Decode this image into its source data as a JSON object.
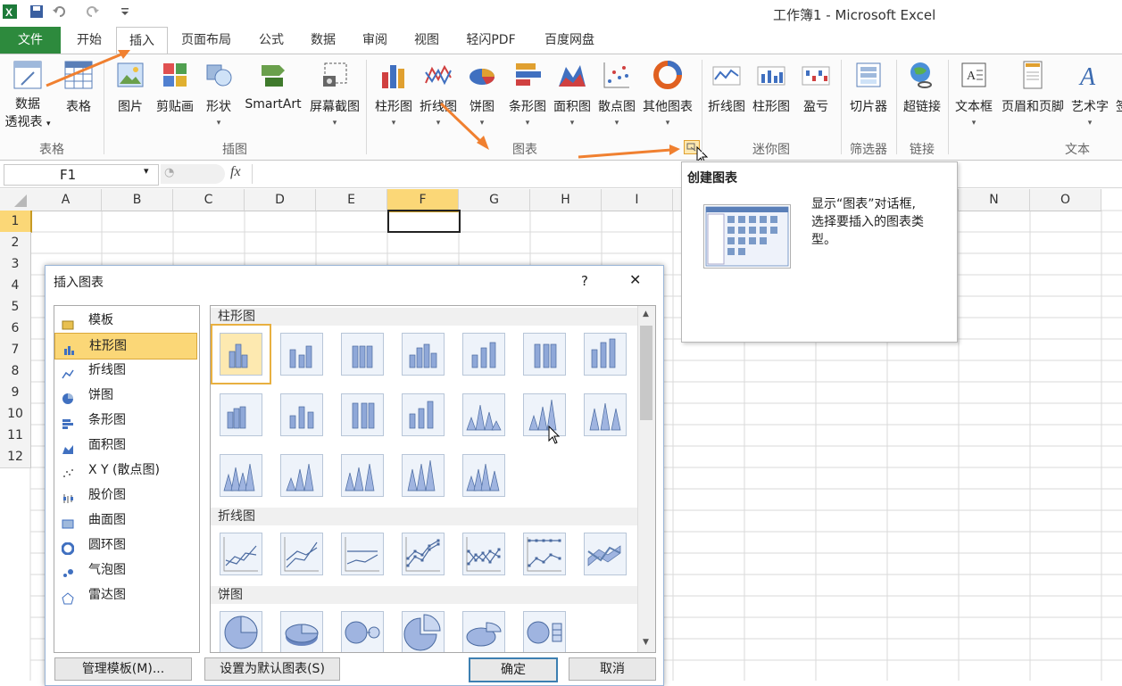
{
  "window": {
    "title": "工作簿1 - Microsoft Excel"
  },
  "tabs": [
    "文件",
    "开始",
    "插入",
    "页面布局",
    "公式",
    "数据",
    "审阅",
    "视图",
    "轻闪PDF",
    "百度网盘"
  ],
  "ribbon": {
    "groups": {
      "tables": "表格",
      "illustrations": "插图",
      "charts": "图表",
      "sparklines": "迷你图",
      "filter": "筛选器",
      "links": "链接",
      "text": "文本"
    },
    "buttons": {
      "pivot_line1": "数据",
      "pivot_line2": "透视表",
      "table": "表格",
      "picture": "图片",
      "clipart": "剪贴画",
      "shapes": "形状",
      "smartart": "SmartArt",
      "screenshot": "屏幕截图",
      "column": "柱形图",
      "line": "折线图",
      "pie": "饼图",
      "bar": "条形图",
      "area": "面积图",
      "scatter": "散点图",
      "other": "其他图表",
      "spark_line": "折线图",
      "spark_column": "柱形图",
      "spark_winloss": "盈亏",
      "slicer": "切片器",
      "hyperlink": "超链接",
      "textbox": "文本框",
      "header_footer": "页眉和页脚",
      "wordart": "艺术字",
      "sign": "签"
    },
    "dropdown_arrow": "▾"
  },
  "formula_bar": {
    "name_box": "F1",
    "fx": "fx"
  },
  "grid": {
    "columns": [
      "A",
      "B",
      "C",
      "D",
      "E",
      "F",
      "G",
      "H",
      "I",
      "J",
      "K",
      "L",
      "M",
      "N",
      "O"
    ],
    "rows": [
      "1",
      "2",
      "3",
      "4",
      "5",
      "6",
      "7",
      "8",
      "9",
      "10",
      "11",
      "12"
    ],
    "selected_cell": "F1"
  },
  "tooltip": {
    "title": "创建图表",
    "line1": "显示“图表”对话框,",
    "line2": "选择要插入的图表类",
    "line3": "型。"
  },
  "dialog": {
    "title": "插入图表",
    "help": "?",
    "close": "✕",
    "categories": [
      "模板",
      "柱形图",
      "折线图",
      "饼图",
      "条形图",
      "面积图",
      "X Y (散点图)",
      "股价图",
      "曲面图",
      "圆环图",
      "气泡图",
      "雷达图"
    ],
    "selected_category": "柱形图",
    "sections": {
      "column": "柱形图",
      "line": "折线图",
      "pie": "饼图"
    },
    "buttons": {
      "manage": "管理模板(M)...",
      "set_default": "设置为默认图表(S)",
      "ok": "确定",
      "cancel": "取消"
    }
  },
  "colors": {
    "accent": "#f08030",
    "file_tab": "#2d8a3d",
    "selection": "#fbd777",
    "grid_line": "#dadada"
  }
}
